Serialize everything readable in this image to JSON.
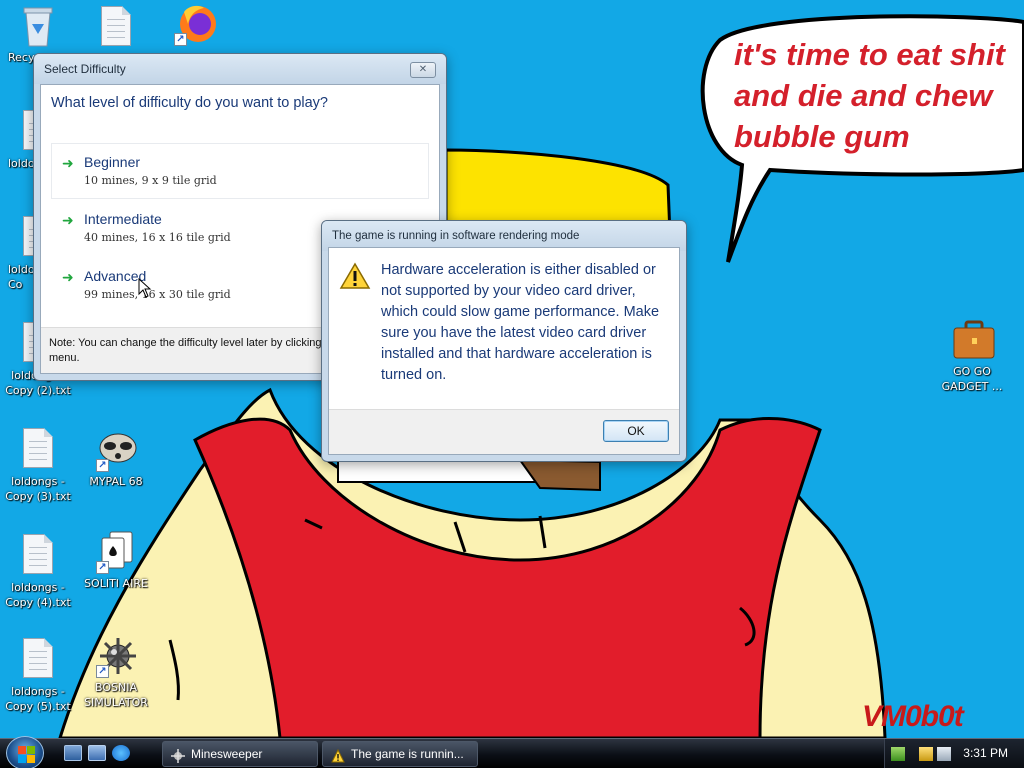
{
  "desktop": {
    "icons": [
      {
        "label": "Recy"
      },
      {
        "label": "loldo"
      },
      {
        "label": "loldo\nCo"
      },
      {
        "label": "loldongs -\nCopy (2).txt"
      },
      {
        "label": "loldongs -\nCopy (3).txt"
      },
      {
        "label": "loldongs -\nCopy (4).txt"
      },
      {
        "label": "loldongs -\nCopy (5).txt"
      },
      {
        "label": "MYPAL 68"
      },
      {
        "label": "SOLITI AIRE"
      },
      {
        "label": "BOSNIA\nSIMULATOR"
      },
      {
        "label": "GO GO\nGADGET ..."
      }
    ],
    "wallpaper": {
      "speech_lines": [
        "it's time to eat shit",
        "and die and chew",
        "bubble gum"
      ],
      "signature": "VM0b0t"
    }
  },
  "difficulty_dialog": {
    "title": "Select Difficulty",
    "question": "What level of difficulty do you want to play?",
    "options": [
      {
        "name": "Beginner",
        "desc": "10 mines, 9 x 9 tile grid"
      },
      {
        "name": "Intermediate",
        "desc": "40 mines, 16 x 16 tile grid"
      },
      {
        "name": "Advanced",
        "desc": "99 mines, 16 x 30 tile grid"
      }
    ],
    "note": "Note: You can change the difficulty level later by clicking Options in the Game menu."
  },
  "alert_dialog": {
    "title": "The game is running in software rendering mode",
    "message": "Hardware acceleration is either disabled or not supported by your video card driver, which could slow game performance. Make sure you have the latest video card driver installed and that hardware acceleration is turned on.",
    "ok_label": "OK"
  },
  "taskbar": {
    "buttons": [
      {
        "label": "Minesweeper"
      },
      {
        "label": "The game is runnin..."
      }
    ],
    "clock": "3:31 PM"
  },
  "colors": {
    "sky": "#12a8e6",
    "shirt": "#e21d2b",
    "skin": "#fbf2b3",
    "hair": "#fde300",
    "accent_text": "#1a3a78"
  }
}
